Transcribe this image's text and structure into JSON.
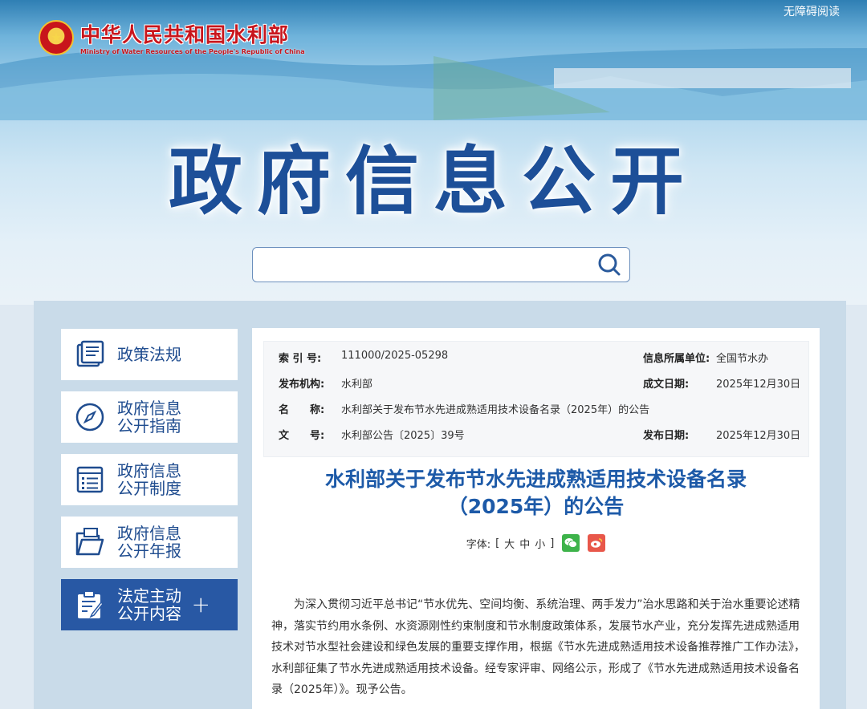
{
  "header": {
    "logo_cn": "中华人民共和国水利部",
    "logo_en": "Ministry of Water Resources of the People's Republic of China",
    "accessibility": "无障碍阅读",
    "banner_title": "政府信息公开"
  },
  "search": {
    "placeholder": "",
    "value": ""
  },
  "sidebar": {
    "items": [
      {
        "label": "政策法规",
        "icon": "book-icon"
      },
      {
        "label": "政府信息\n公开指南",
        "icon": "compass-icon"
      },
      {
        "label": "政府信息\n公开制度",
        "icon": "list-doc-icon"
      },
      {
        "label": "政府信息\n公开年报",
        "icon": "folder-icon"
      },
      {
        "label": "法定主动\n公开内容",
        "icon": "clipboard-edit-icon",
        "active": true,
        "expand": "+"
      }
    ]
  },
  "meta": {
    "index_label": "索 引 号:",
    "index_value": "111000/2025-05298",
    "unit_label": "信息所属单位:",
    "unit_value": "全国节水办",
    "publisher_label": "发布机构:",
    "publisher_value": "水利部",
    "created_label": "成文日期:",
    "created_value": "2025年12月30日",
    "name_label": "名　　称:",
    "name_value": "水利部关于发布节水先进成熟适用技术设备名录（2025年）的公告",
    "doc_label": "文　　号:",
    "doc_value": "水利部公告〔2025〕39号",
    "published_label": "发布日期:",
    "published_value": "2025年12月30日"
  },
  "article": {
    "title_line1": "水利部关于发布节水先进成熟适用技术设备名录",
    "title_line2": "（2025年）的公告",
    "fontsize_label": "字体:",
    "fontsize_open": "[",
    "size_large": "大",
    "size_medium": "中",
    "size_small": "小",
    "fontsize_close": "]",
    "body": "为深入贯彻习近平总书记“节水优先、空间均衡、系统治理、两手发力”治水思路和关于治水重要论述精神，落实节约用水条例、水资源刚性约束制度和节水制度政策体系，发展节水产业，充分发挥先进成熟适用技术对节水型社会建设和绿色发展的重要支撑作用，根据《节水先进成熟适用技术设备推荐推广工作办法》，水利部征集了节水先进成熟适用技术设备。经专家评审、网络公示，形成了《节水先进成熟适用技术设备名录（2025年）》。现予公告。"
  },
  "colors": {
    "brand_blue": "#1d5aa8",
    "active_blue": "#2858a4",
    "logo_red": "#c8161d"
  }
}
